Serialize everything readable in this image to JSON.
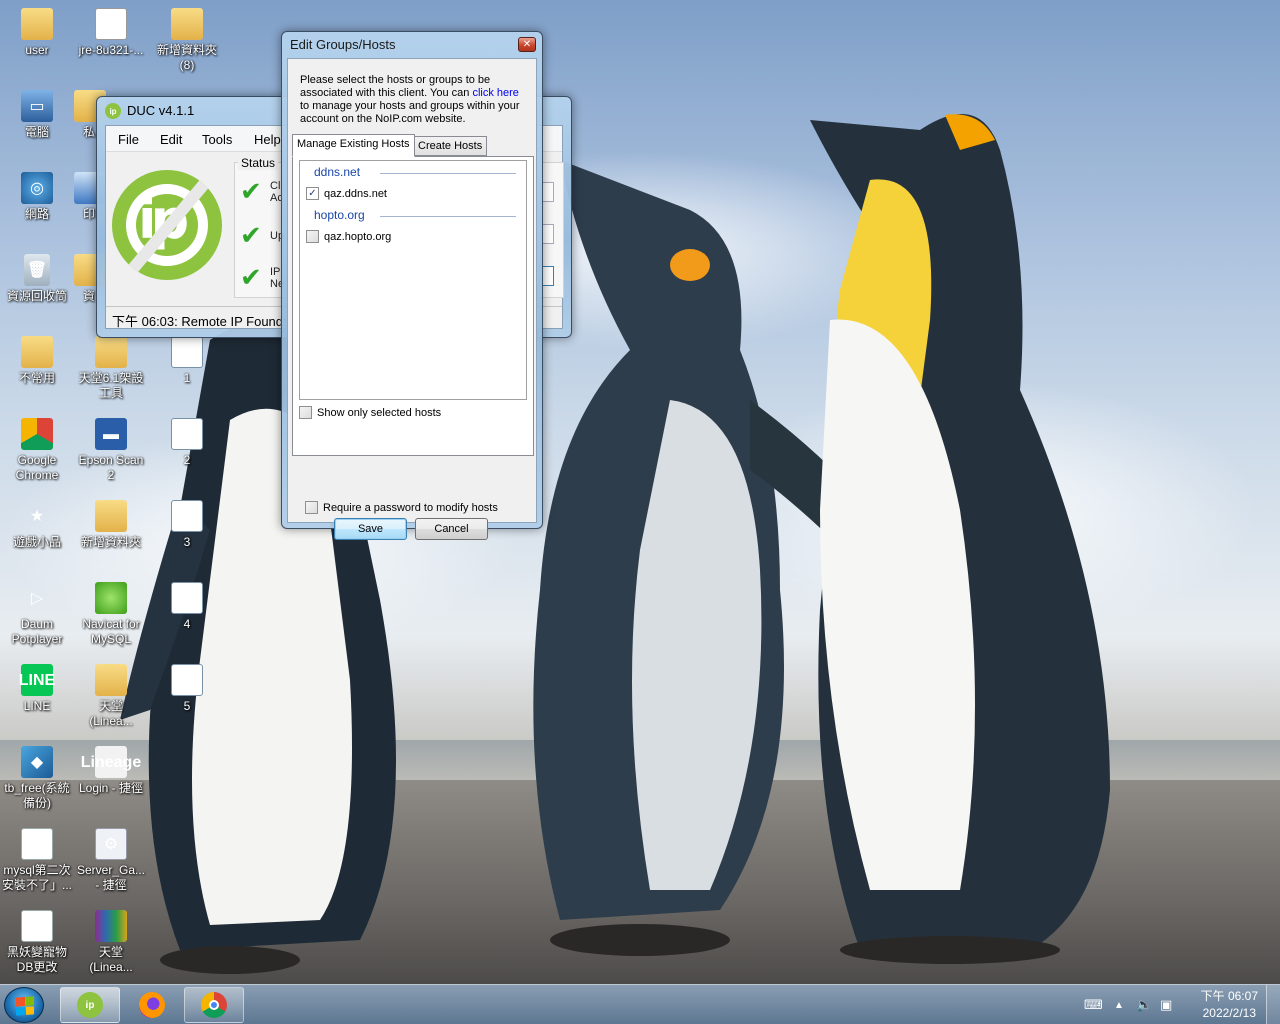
{
  "desktop": {
    "icons": [
      {
        "label": "user",
        "glyph": "",
        "icon": "user-folder-icon"
      },
      {
        "label": "jre-8u321-...",
        "glyph": "☕",
        "icon": "java-installer-icon"
      },
      {
        "label": "新增資料夾\n(8)",
        "glyph": "",
        "icon": "folder-icon"
      },
      {
        "label": "電腦",
        "glyph": "▭",
        "icon": "computer-icon"
      },
      {
        "label": "私",
        "glyph": "",
        "icon": "folder-icon"
      },
      {
        "label": "網路",
        "glyph": "◎",
        "icon": "network-icon"
      },
      {
        "label": "印",
        "glyph": "",
        "icon": "printer-icon"
      },
      {
        "label": "資源回收筒",
        "glyph": "🗑",
        "icon": "recycle-bin-icon"
      },
      {
        "label": "資",
        "glyph": "",
        "icon": "folder-icon"
      },
      {
        "label": "不常用",
        "glyph": "",
        "icon": "folder-icon"
      },
      {
        "label": "天堂6.1架設\n工具",
        "glyph": "",
        "icon": "folder-icon"
      },
      {
        "label": "1",
        "glyph": "▤",
        "icon": "screenshot-thumb-icon"
      },
      {
        "label": "Google\nChrome",
        "glyph": "",
        "icon": "chrome-icon"
      },
      {
        "label": "Epson Scan\n2",
        "glyph": "▬",
        "icon": "epson-scan-icon"
      },
      {
        "label": "2",
        "glyph": "▤",
        "icon": "screenshot-thumb-icon"
      },
      {
        "label": "遊戲小品",
        "glyph": "★",
        "icon": "star-icon"
      },
      {
        "label": "新增資料夾",
        "glyph": "",
        "icon": "folder-icon"
      },
      {
        "label": "3",
        "glyph": "▤",
        "icon": "screenshot-thumb-icon"
      },
      {
        "label": "Daum\nPotplayer",
        "glyph": "▷",
        "icon": "potplayer-icon"
      },
      {
        "label": "Navicat for\nMySQL",
        "glyph": "",
        "icon": "navicat-icon"
      },
      {
        "label": "4",
        "glyph": "▤",
        "icon": "screenshot-thumb-icon"
      },
      {
        "label": "LINE",
        "glyph": "LINE",
        "icon": "line-icon"
      },
      {
        "label": "天堂\n(Linea...",
        "glyph": "",
        "icon": "folder-icon"
      },
      {
        "label": "5",
        "glyph": "▤",
        "icon": "screenshot-thumb-icon"
      },
      {
        "label": "tb_free(系統\n備份)",
        "glyph": "◆",
        "icon": "backup-icon"
      },
      {
        "label": "Login - 捷徑",
        "glyph": "Lineage",
        "icon": "login-shortcut-icon"
      },
      {
        "label": "mysql第二次\n安裝不了」...",
        "glyph": "W",
        "icon": "word-document-icon"
      },
      {
        "label": "Server_Ga...\n- 捷徑",
        "glyph": "⚙",
        "icon": "server-shortcut-icon"
      },
      {
        "label": "黑妖變寵物\nDB更改",
        "glyph": "W",
        "icon": "word-document-icon"
      },
      {
        "label": "天堂\n(Linea...",
        "glyph": "",
        "icon": "winrar-archive-icon"
      }
    ]
  },
  "duc_window": {
    "title": "DUC v4.1.1",
    "menu": [
      "File",
      "Edit",
      "Tools",
      "Help"
    ],
    "status_label": "Status",
    "status_items": [
      {
        "text": "Cl\nAc"
      },
      {
        "text": "Up"
      },
      {
        "text": "IP\nNe"
      }
    ],
    "statusbar": "下午 06:03: Remote IP Found: 1"
  },
  "edit_groups_dialog": {
    "title": "Edit Groups/Hosts",
    "close_label": "✕",
    "intro_before_link": "Please select the hosts or groups to be associated with this client. You can ",
    "intro_link": "click here",
    "intro_after_link": " to manage your hosts and groups within your account on the NoIP.com website.",
    "tabs": [
      "Manage Existing Hosts",
      "Create Hosts"
    ],
    "active_tab": "Manage Existing Hosts",
    "groups": [
      {
        "name": "ddns.net",
        "hosts": [
          {
            "name": "qaz.ddns.net",
            "checked": true
          }
        ]
      },
      {
        "name": "hopto.org",
        "hosts": [
          {
            "name": "qaz.hopto.org",
            "checked": false
          }
        ]
      }
    ],
    "show_only_selected_label": "Show only selected hosts",
    "show_only_selected_checked": false,
    "require_password_label": "Require a password to modify hosts",
    "require_password_checked": false,
    "save_label": "Save",
    "cancel_label": "Cancel"
  },
  "taskbar": {
    "pinned": [
      {
        "name": "DUC",
        "icon": "noip-duc-icon",
        "active": true
      },
      {
        "name": "Firefox",
        "icon": "firefox-icon",
        "active": false
      },
      {
        "name": "Google Chrome",
        "icon": "chrome-icon",
        "active": false
      }
    ],
    "clock_time": "下午 06:07",
    "clock_date": "2022/2/13"
  }
}
